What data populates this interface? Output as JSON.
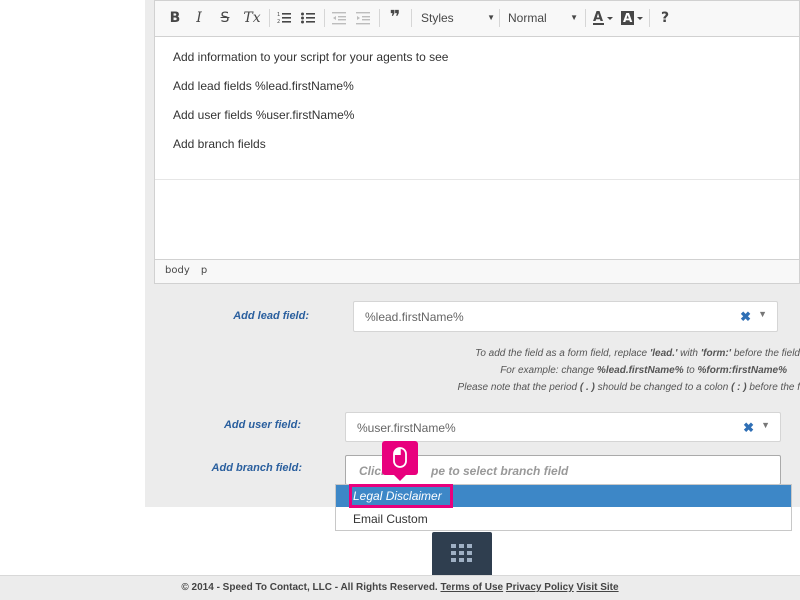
{
  "toolbar": {
    "bold_icon": "B",
    "italic_icon": "I",
    "strike_icon": "S",
    "clear_format_icon": "Tx",
    "blockquote_icon": "❞",
    "help_icon": "?",
    "styles_label": "Styles",
    "format_label": "Normal"
  },
  "editor": {
    "lines": [
      "Add information to your script for your agents to see",
      "Add lead fields %lead.firstName%",
      "Add user fields %user.firstName%",
      "Add branch fields"
    ],
    "status_path": [
      "body",
      "p"
    ]
  },
  "form": {
    "lead_label": "Add lead field:",
    "lead_value": "%lead.firstName%",
    "hint_line1_pre": "To add the field as a form field, replace ",
    "hint_line1_b1": "'lead.'",
    "hint_line1_mid": " with ",
    "hint_line1_b2": "'form:'",
    "hint_line1_post": " before the field",
    "hint_line2_pre": "For example: change ",
    "hint_line2_b1": "%lead.firstName%",
    "hint_line2_mid": " to ",
    "hint_line2_b2": "%form:firstName%",
    "hint_line3_pre": "Please note that the period ",
    "hint_line3_b1": "( . )",
    "hint_line3_mid": " should be changed to a colon ",
    "hint_line3_b2": "( : )",
    "hint_line3_post": " before the f",
    "user_label": "Add user field:",
    "user_value": "%user.firstName%",
    "branch_label": "Add branch field:",
    "branch_placeholder_a": "Click",
    "branch_placeholder_b": "pe to select branch field",
    "branch_options": [
      "Legal Disclaimer",
      "Email Custom"
    ]
  },
  "footer": {
    "copyright": "© 2014 - Speed To Contact, LLC - All Rights Reserved.",
    "terms": "Terms of Use",
    "privacy": "Privacy Policy",
    "visit": "Visit Site"
  },
  "colors": {
    "accent": "#e8007d",
    "selected_option": "#3d87c7",
    "label_blue": "#2a5f9e"
  }
}
